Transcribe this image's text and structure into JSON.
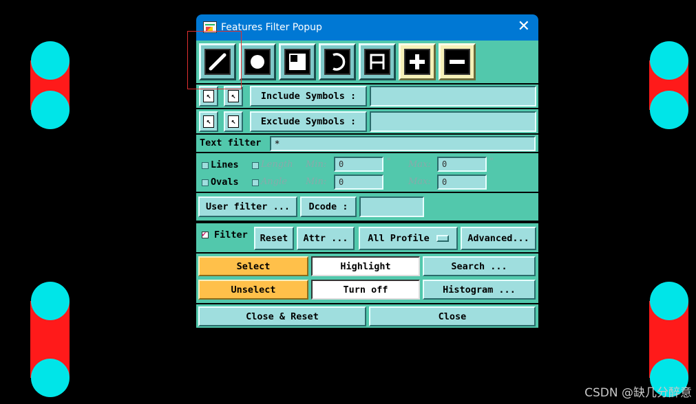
{
  "window": {
    "title": "Features Filter Popup",
    "close_glyph": "✕"
  },
  "tools": [
    {
      "name": "line-tool-icon"
    },
    {
      "name": "pad-tool-icon"
    },
    {
      "name": "surface-tool-icon"
    },
    {
      "name": "arc-tool-icon"
    },
    {
      "name": "text-tool-icon"
    },
    {
      "name": "add-tool-icon"
    },
    {
      "name": "remove-tool-icon"
    }
  ],
  "include_symbols": {
    "label": "Include Symbols :",
    "value": ""
  },
  "exclude_symbols": {
    "label": "Exclude Symbols :",
    "value": ""
  },
  "text_filter": {
    "label": "Text filter",
    "value": "*"
  },
  "lines": {
    "label": "Lines",
    "length_label": "Length",
    "min_label": "Min:",
    "min_value": "0",
    "max_label": "Max:",
    "max_value": "0",
    "unit_min": "\"",
    "unit_max": "\""
  },
  "ovals": {
    "label": "Ovals",
    "angle_label": "Angle",
    "min_label": "Min:",
    "min_value": "0",
    "max_label": "Max:",
    "max_value": "0"
  },
  "user_filter": {
    "label": "User filter ..."
  },
  "dcode": {
    "label": "Dcode :",
    "value": ""
  },
  "filter_bar": {
    "filter_label": "Filter",
    "filter_checked": true,
    "reset": "Reset",
    "attr": "Attr ...",
    "profile": "All Profile",
    "advanced": "Advanced..."
  },
  "actions": {
    "select": "Select",
    "highlight": "Highlight",
    "search": "Search ...",
    "unselect": "Unselect",
    "turn_off": "Turn off",
    "histogram": "Histogram ..."
  },
  "bottom": {
    "close_reset": "Close & Reset",
    "close": "Close"
  },
  "watermark": "CSDN @缺几分醉意",
  "colors": {
    "title_bar": "#0078d4",
    "panel": "#52c8ac",
    "button": "#9fdede",
    "select_button": "#ffc04a",
    "pad_red": "#ff1a1a",
    "pad_cyan": "#00e5e8"
  }
}
